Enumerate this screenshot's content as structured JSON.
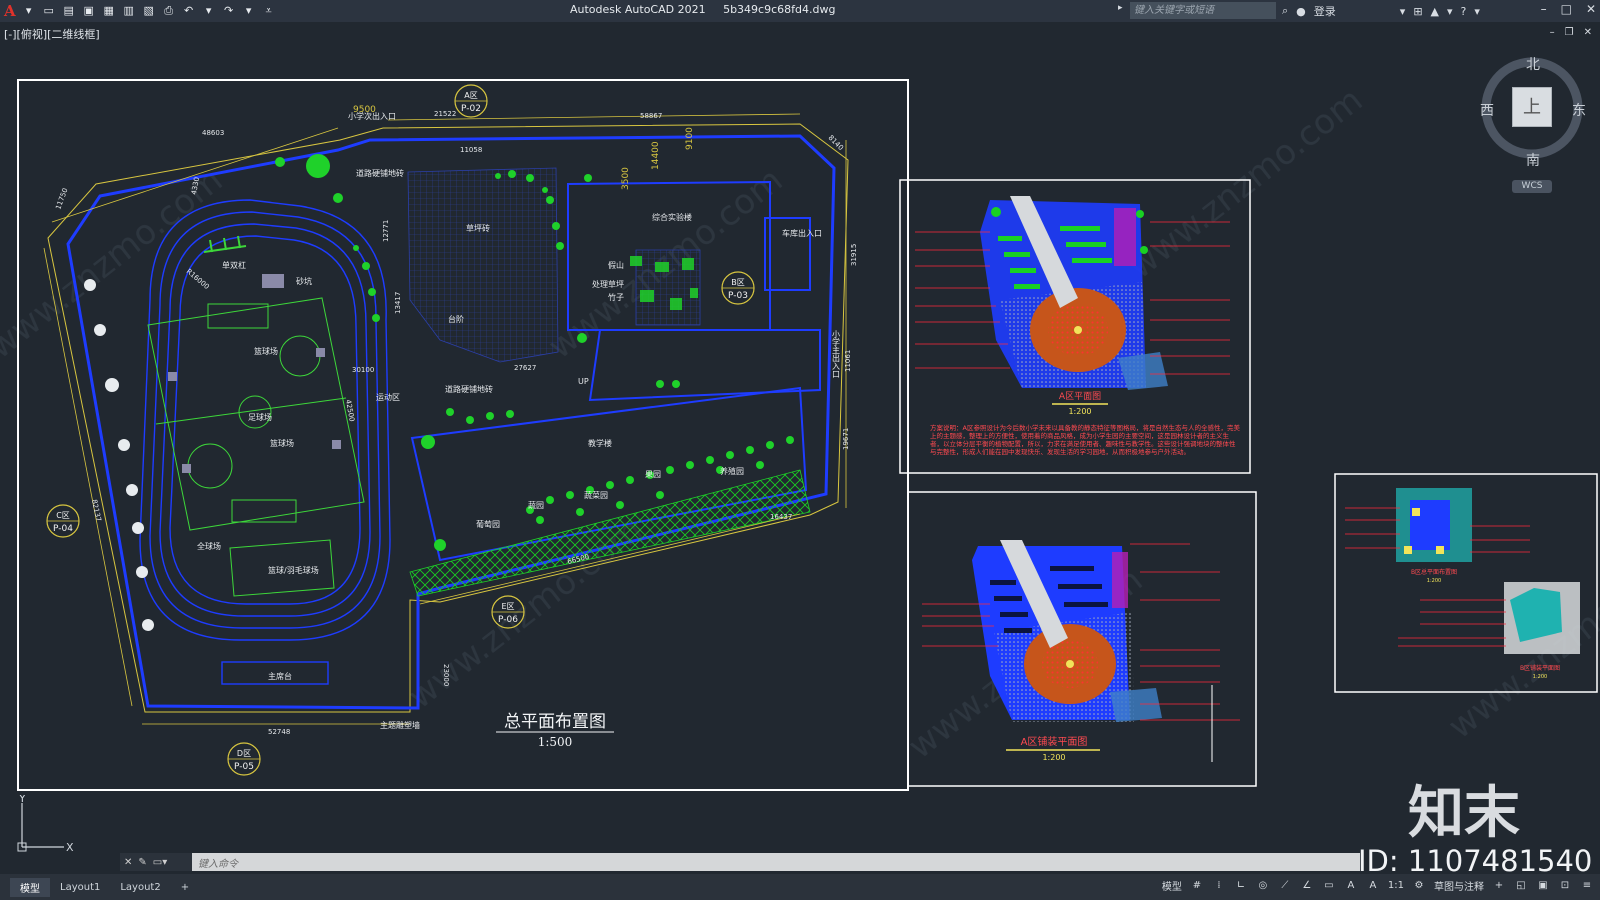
{
  "titlebar": {
    "app_logo": "A",
    "app_name": "Autodesk AutoCAD 2021",
    "file_name": "5b349c9c68fd4.dwg",
    "search_placeholder": "键入关键字或短语",
    "login_label": "登录"
  },
  "viewport": {
    "view_label": "[-][俯视][二维线框]"
  },
  "viewcube": {
    "north": "北",
    "south": "南",
    "east": "东",
    "west": "西",
    "face": "上",
    "wcs": "WCS"
  },
  "drawing": {
    "master_plan_title": "总平面布置图",
    "master_plan_scale": "1:500",
    "zones": {
      "a": {
        "name": "A区",
        "code": "P-02"
      },
      "b": {
        "name": "B区",
        "code": "P-03"
      },
      "c": {
        "name": "C区",
        "code": "P-04"
      },
      "d": {
        "name": "D区",
        "code": "P-05"
      },
      "e": {
        "name": "E区",
        "code": "P-06"
      }
    },
    "labels": {
      "primary_entrance": "小学次出入口",
      "fire_lane_1": "道路硬铺地砖",
      "fire_lane_2": "道路硬铺地砖",
      "lab_building": "综合实验楼",
      "garage_entrance": "车库出入口",
      "lawn": "草坪砖",
      "rockery": "假山",
      "bamboo": "竹子",
      "landscape_wall": "处理草坪",
      "steps": "台阶",
      "parallel_bars": "单双杠",
      "sandpit": "砂坑",
      "basketball_1": "篮球场",
      "football": "足球场",
      "basketball_2": "篮球场",
      "volleyball": "全球场",
      "badminton": "篮球/羽毛球场",
      "activity_area": "运动区",
      "main_stage": "主席台",
      "main_road": "主题雕塑墙",
      "teaching_building": "教学楼",
      "up": "UP",
      "main_entrance": "小学主出入口",
      "garden_1": "蔬菜园",
      "garden_2": "果园",
      "garden_3": "葡萄园",
      "garden_4": "养殖园",
      "garden_5": "蔬园"
    },
    "dimensions": {
      "d1": "48603",
      "d2": "9500",
      "d3": "21522",
      "d4": "58867",
      "d5": "11058",
      "d6": "14400",
      "d7": "9100",
      "d8": "3500",
      "d9": "8140",
      "d10": "31915",
      "d11": "11061",
      "d12": "19671",
      "d13": "16437",
      "d14": "66500",
      "d15": "23000",
      "d16": "52748",
      "d17": "12771",
      "d18": "13417",
      "d19": "27627",
      "d20": "82137",
      "d21": "11750",
      "d22": "4330",
      "d23": "R16000",
      "d24": "42500",
      "d25": "30100"
    },
    "detail_a_title": "A区平面图",
    "detail_a_scale": "1:200",
    "detail_a_notes": "方案说明：A区参照设计为今后数小学未来以具备教的静态特征等图格局，将是自然生态与人的全感性，完美上的主题感，整理上的方便性，使用着的商品风格，成为小学生园的主要空间，这是园林设计者的主义生者，以立体分层平衡的植物配置，所以，力求在满足使用者、趣味性与教学性。这些设计强调地块的整体性与完整性，形成人们能在园中发现快乐、发现生活的学习园地，从而积极地参与户外活动。",
    "detail_b_title": "A区铺装平面图",
    "detail_b_scale": "1:200",
    "detail_c_title1": "B区总平面布置图",
    "detail_c_title2": "B区铺装平面图",
    "detail_c_scale": "1:200"
  },
  "command": {
    "placeholder": "键入命令"
  },
  "tabs": [
    "模型",
    "Layout1",
    "Layout2"
  ],
  "status": {
    "model_label": "模型",
    "scale": "1:1",
    "workspace": "草图与注释"
  },
  "watermark": {
    "brand": "知末",
    "id_text": "ID: 1107481540",
    "diag": "www.znzmo.com"
  },
  "colors": {
    "background": "#212830",
    "paper_frame": "#ffffff",
    "plan_blue": "#1e3cff",
    "plan_green": "#1fd12a",
    "plan_yellow": "#d8c640",
    "plan_red": "#ff2a3a"
  }
}
